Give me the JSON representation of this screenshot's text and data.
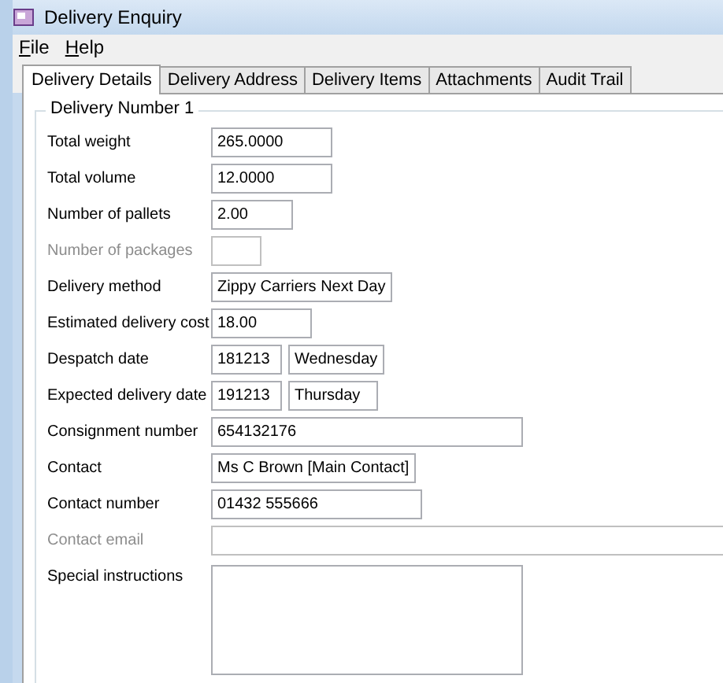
{
  "window": {
    "title": "Delivery Enquiry"
  },
  "menu": [
    "File",
    "Help"
  ],
  "tabs": [
    {
      "label": "Delivery Details",
      "selected": true
    },
    {
      "label": "Delivery Address",
      "selected": false
    },
    {
      "label": "Delivery Items",
      "selected": false
    },
    {
      "label": "Attachments",
      "selected": false
    },
    {
      "label": "Audit Trail",
      "selected": false
    }
  ],
  "group": {
    "title": "Delivery Number 1",
    "rows": [
      {
        "label": "Total weight",
        "disabled": false,
        "kind": "single",
        "values": [
          "265.0000"
        ]
      },
      {
        "label": "Total volume",
        "disabled": false,
        "kind": "single",
        "values": [
          "12.0000"
        ]
      },
      {
        "label": "Number of pallets",
        "disabled": false,
        "kind": "single",
        "values": [
          "2.00"
        ]
      },
      {
        "label": "Number of packages",
        "disabled": true,
        "kind": "single",
        "values": []
      },
      {
        "label": "Delivery method",
        "disabled": false,
        "kind": "single",
        "values": [
          "Zippy Carriers Next Day"
        ]
      },
      {
        "label": "Estimated delivery cost",
        "disabled": false,
        "kind": "single",
        "values": [
          "18.00"
        ]
      },
      {
        "label": "Despatch date",
        "disabled": false,
        "kind": "pair",
        "values": [
          "181213",
          "Wednesday"
        ]
      },
      {
        "label": "Expected delivery date",
        "disabled": false,
        "kind": "pair",
        "values": [
          "191213",
          "Thursday"
        ]
      },
      {
        "label": "Consignment number",
        "disabled": false,
        "kind": "single",
        "values": [
          "654132176"
        ]
      },
      {
        "label": "Contact",
        "disabled": false,
        "kind": "single",
        "values": [
          "Ms C Brown [Main Contact]"
        ]
      },
      {
        "label": "Contact number",
        "disabled": false,
        "kind": "single",
        "values": [
          "01432 555666"
        ]
      },
      {
        "label": "Contact email",
        "disabled": true,
        "kind": "single",
        "values": []
      },
      {
        "label": "Special instructions",
        "disabled": false,
        "kind": "multiline",
        "values": []
      }
    ]
  }
}
